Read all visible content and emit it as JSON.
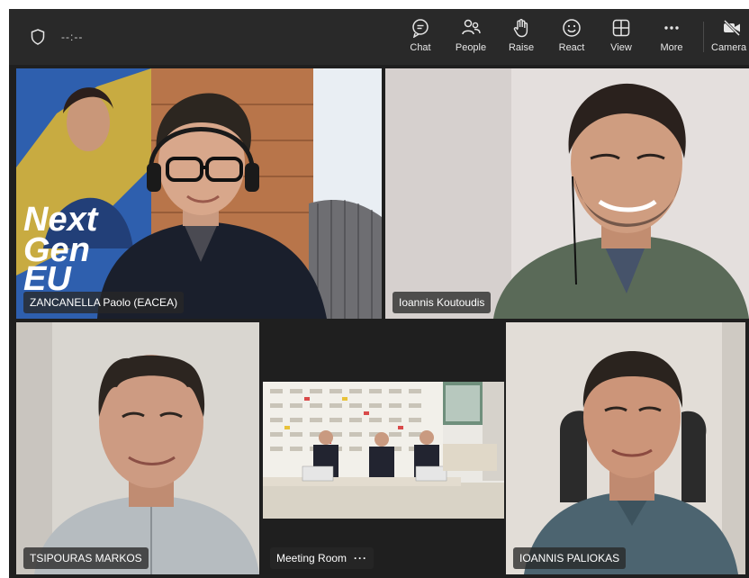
{
  "toolbar": {
    "timer": "--:--",
    "buttons": {
      "chat": "Chat",
      "people": "People",
      "raise": "Raise",
      "react": "React",
      "view": "View",
      "more": "More",
      "camera": "Camera"
    }
  },
  "participants": [
    {
      "name": "ZANCANELLA Paolo (EACEA)",
      "speaking": true
    },
    {
      "name": "Ioannis Koutoudis",
      "speaking": false
    },
    {
      "name": "TSIPOURAS MARKOS",
      "speaking": false
    },
    {
      "name": "Meeting Room",
      "speaking": false,
      "more": "···"
    },
    {
      "name": "IOANNIS PALIOKAS",
      "speaking": true
    }
  ],
  "background_poster": {
    "lines": [
      "Next",
      "Gen",
      "EU"
    ]
  },
  "colors": {
    "active_outline": "#8c8ef0",
    "toolbar_bg": "#292929",
    "stage_bg": "#1f1f1f"
  }
}
